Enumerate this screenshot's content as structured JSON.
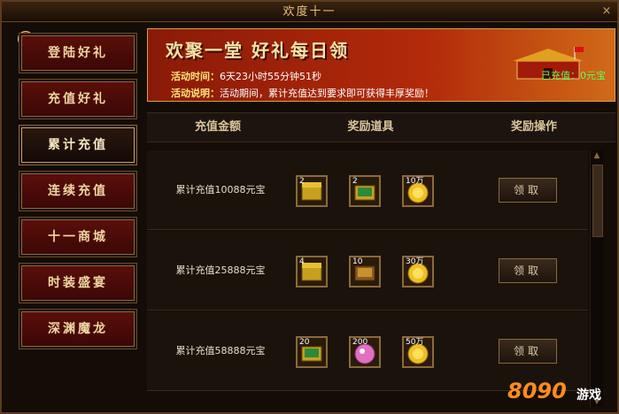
{
  "window": {
    "title": "欢度十一",
    "close": "×"
  },
  "sidebar": {
    "badge": "1",
    "items": [
      {
        "label": "登陆好礼",
        "active": false
      },
      {
        "label": "充值好礼",
        "active": false
      },
      {
        "label": "累计充值",
        "active": true
      },
      {
        "label": "连续充值",
        "active": false
      },
      {
        "label": "十一商城",
        "active": false
      },
      {
        "label": "时装盛宴",
        "active": false
      },
      {
        "label": "深渊魔龙",
        "active": false
      }
    ]
  },
  "banner": {
    "title": "欢聚一堂 好礼每日领",
    "time_label": "活动时间：",
    "time_value": "6天23小时55分钟51秒",
    "desc_label": "活动说明：",
    "desc_value": "活动期间，累计充值达到要求即可获得丰厚奖励！",
    "already": "已充值：0元宝"
  },
  "table": {
    "headers": [
      "充值金额",
      "奖励道具",
      "奖励操作"
    ],
    "rows": [
      {
        "label": "累计充值10088元宝",
        "items": [
          {
            "count": "2",
            "icon": "gold-chest-icon"
          },
          {
            "count": "2",
            "icon": "green-chest-icon"
          },
          {
            "count": "10万",
            "icon": "gold-coin-icon"
          }
        ],
        "action": "领取"
      },
      {
        "label": "累计充值25888元宝",
        "items": [
          {
            "count": "4",
            "icon": "gold-chest-icon"
          },
          {
            "count": "10",
            "icon": "brown-chest-icon"
          },
          {
            "count": "30万",
            "icon": "gold-coin-icon"
          }
        ],
        "action": "领取"
      },
      {
        "label": "累计充值58888元宝",
        "items": [
          {
            "count": "20",
            "icon": "green-chest-icon"
          },
          {
            "count": "200",
            "icon": "pink-orb-icon"
          },
          {
            "count": "50万",
            "icon": "gold-coin-icon"
          }
        ],
        "action": "领取"
      }
    ]
  },
  "watermark": {
    "number": "8090",
    "suffix": "游戏"
  },
  "colors": {
    "gold": "#e8c27a",
    "red": "#5b0f0a",
    "green": "#5cff5c",
    "yellow": "#ffe57a"
  }
}
